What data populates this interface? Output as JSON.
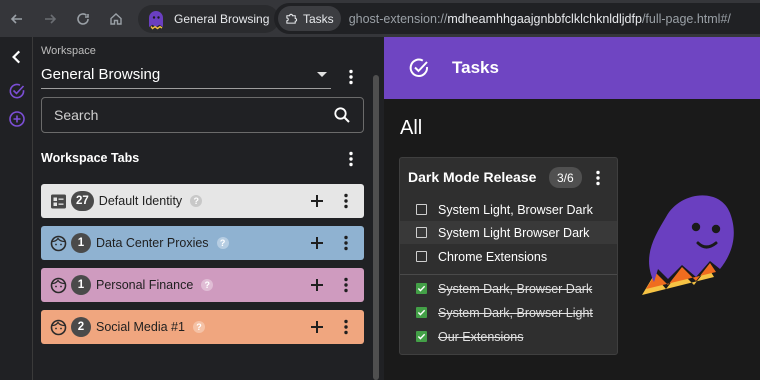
{
  "browser": {
    "extension_name": "General Browsing",
    "tasks_chip_label": "Tasks",
    "url_scheme": "ghost-extension://",
    "url_host": "mdheamhhgaajgnbbfclklchknldljdfp",
    "url_path": "/full-page.html#/"
  },
  "sidebar": {
    "workspace_label": "Workspace",
    "workspace_value": "General Browsing",
    "search_placeholder": "Search",
    "section_title": "Workspace Tabs",
    "tabs": [
      {
        "count": "27",
        "label": "Default Identity",
        "color": "#e6e6e6",
        "icon": "identity-card-icon"
      },
      {
        "count": "1",
        "label": "Data Center Proxies",
        "color": "#8fb2d1",
        "icon": "face-icon"
      },
      {
        "count": "1",
        "label": "Personal Finance",
        "color": "#cf9bbf",
        "icon": "face-icon"
      },
      {
        "count": "2",
        "label": "Social Media #1",
        "color": "#f0a67f",
        "icon": "face-icon"
      }
    ]
  },
  "main": {
    "header_title": "Tasks",
    "filter_label": "All",
    "card": {
      "title": "Dark Mode Release",
      "count": "3/6",
      "tasks": [
        {
          "label": "System Light, Browser Dark",
          "done": false
        },
        {
          "label": "System Light Browser Dark",
          "done": false
        },
        {
          "label": "Chrome Extensions",
          "done": false
        },
        {
          "label": "System Dark, Browser Dark",
          "done": true
        },
        {
          "label": "System Dark, Browser Light",
          "done": true
        },
        {
          "label": "Our Extensions",
          "done": true
        }
      ]
    }
  },
  "colors": {
    "accent_purple": "#6f45c2",
    "ghost_purple": "#6a3fc0",
    "check_green": "#43a047"
  }
}
